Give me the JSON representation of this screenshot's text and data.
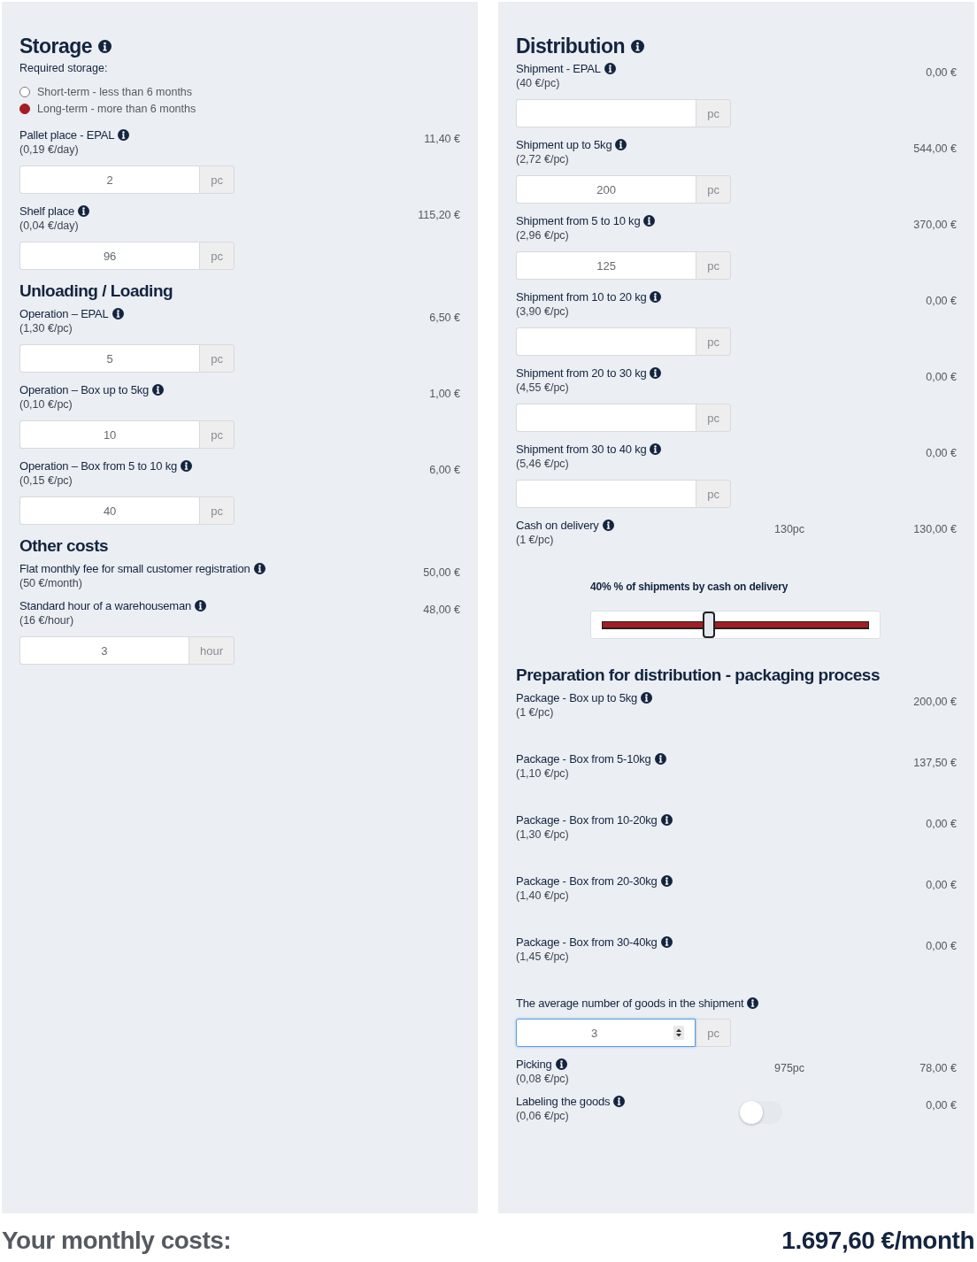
{
  "panels": [
    {
      "sections": [
        {
          "kind": "main",
          "title": "Storage",
          "info": true,
          "subtitle": "Required storage:",
          "options": [
            {
              "label": "Short-term - less than 6 months",
              "selected": false
            },
            {
              "label": "Long-term - more than 6 months",
              "selected": true
            }
          ],
          "items": [
            {
              "kind": "input",
              "label": "Pallet place - EPAL",
              "rate": "(0,19 €/day)",
              "amount": "11,40 €",
              "value": "2",
              "unit": "pc"
            },
            {
              "kind": "input",
              "label": "Shelf place",
              "rate": "(0,04 €/day)",
              "amount": "115,20 €",
              "value": "96",
              "unit": "pc"
            }
          ]
        },
        {
          "kind": "sub",
          "title": "Unloading / Loading",
          "info": false,
          "items": [
            {
              "kind": "input",
              "label": "Operation – EPAL",
              "rate": "(1,30 €/pc)",
              "amount": "6,50 €",
              "value": "5",
              "unit": "pc"
            },
            {
              "kind": "input",
              "label": "Operation – Box up to 5kg",
              "rate": "(0,10 €/pc)",
              "amount": "1,00 €",
              "value": "10",
              "unit": "pc"
            },
            {
              "kind": "input",
              "label": "Operation – Box from 5 to 10 kg",
              "rate": "(0,15 €/pc)",
              "amount": "6,00 €",
              "value": "40",
              "unit": "pc"
            }
          ]
        },
        {
          "kind": "sub",
          "title": "Other costs",
          "info": false,
          "items": [
            {
              "kind": "plain",
              "label": "Flat monthly fee for small customer registration",
              "rate": "(50 €/month)",
              "amount": "50,00 €"
            },
            {
              "kind": "input",
              "label": "Standard hour of a warehouseman",
              "rate": "(16 €/hour)",
              "amount": "48,00 €",
              "value": "3",
              "unit": "hour"
            }
          ]
        }
      ]
    },
    {
      "sections": [
        {
          "kind": "main",
          "title": "Distribution",
          "info": true,
          "items": [
            {
              "kind": "input",
              "label": "Shipment - EPAL",
              "rate": "(40 €/pc)",
              "amount": "0,00 €",
              "unit": "pc"
            },
            {
              "kind": "input",
              "label": "Shipment up to 5kg",
              "rate": "(2,72 €/pc)",
              "amount": "544,00 €",
              "value": "200",
              "unit": "pc"
            },
            {
              "kind": "input",
              "label": "Shipment from 5 to 10 kg",
              "rate": "(2,96 €/pc)",
              "amount": "370,00 €",
              "value": "125",
              "unit": "pc"
            },
            {
              "kind": "input",
              "label": "Shipment from 10 to 20 kg",
              "rate": "(3,90 €/pc)",
              "amount": "0,00 €",
              "unit": "pc"
            },
            {
              "kind": "input",
              "label": "Shipment from 20 to 30 kg",
              "rate": "(4,55 €/pc)",
              "amount": "0,00 €",
              "unit": "pc"
            },
            {
              "kind": "input",
              "label": "Shipment from 30 to 40 kg",
              "rate": "(5,46 €/pc)",
              "amount": "0,00 €",
              "unit": "pc"
            },
            {
              "kind": "count",
              "label": "Cash on delivery",
              "rate": "(1 €/pc)",
              "count": "130pc",
              "amount": "130,00 €"
            },
            {
              "kind": "slider",
              "label": "40% % of shipments by cash on delivery",
              "level": 0.4
            }
          ]
        },
        {
          "kind": "sub",
          "title": "Preparation for distribution - packaging process",
          "info": false,
          "items": [
            {
              "kind": "spaced",
              "label": "Package - Box up to 5kg",
              "rate": "(1 €/pc)",
              "amount": "200,00 €"
            },
            {
              "kind": "spaced",
              "label": "Package - Box from 5-10kg",
              "rate": "(1,10 €/pc)",
              "amount": "137,50 €"
            },
            {
              "kind": "spaced",
              "label": "Package - Box from 10-20kg",
              "rate": "(1,30 €/pc)",
              "amount": "0,00 €"
            },
            {
              "kind": "spaced",
              "label": "Package - Box from 20-30kg",
              "rate": "(1,40 €/pc)",
              "amount": "0,00 €"
            },
            {
              "kind": "spaced",
              "label": "Package - Box from 30-40kg",
              "rate": "(1,45 €/pc)",
              "amount": "0,00 €"
            },
            {
              "kind": "spin",
              "label": "The average number of goods in the shipment",
              "value": "3",
              "unit": "pc",
              "focused": true
            },
            {
              "kind": "count",
              "label": "Picking",
              "rate": "(0,08 €/pc)",
              "count": "975pc",
              "amount": "78,00 €"
            },
            {
              "kind": "toggle",
              "label": "Labeling the goods",
              "rate": "(0,06 €/pc)",
              "on": false,
              "amount": "0,00 €"
            }
          ]
        }
      ]
    }
  ],
  "summary": {
    "label": "Your monthly costs:",
    "total": "1.697,60 €/month"
  }
}
